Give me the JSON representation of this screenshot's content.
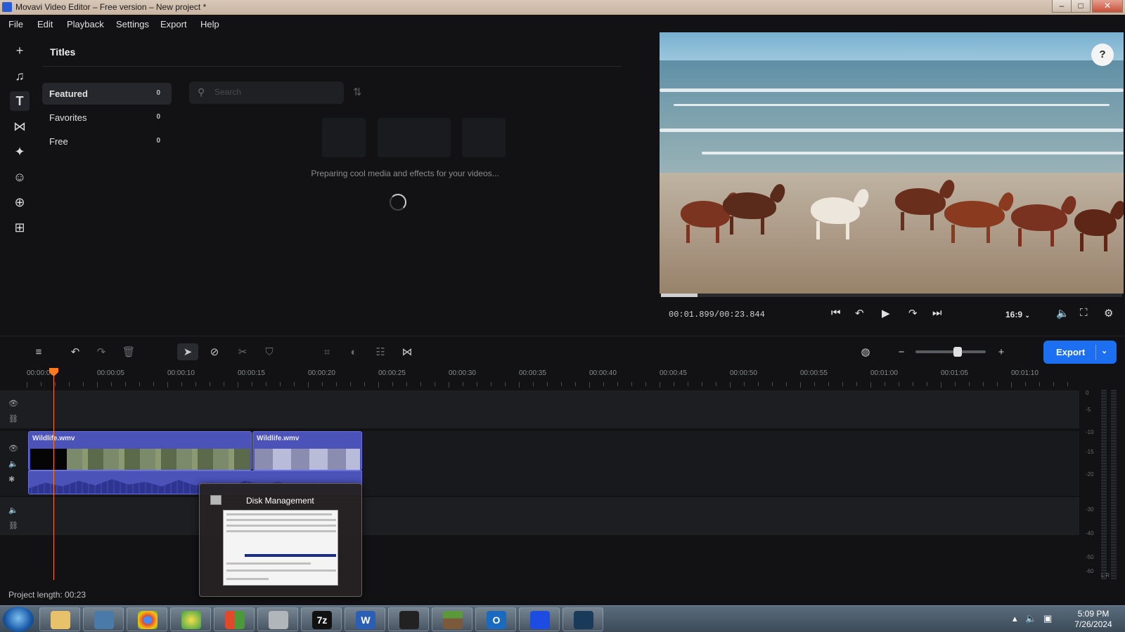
{
  "window": {
    "title": "Movavi Video Editor – Free version – New project *"
  },
  "menu": [
    "File",
    "Edit",
    "Playback",
    "Settings",
    "Export",
    "Help"
  ],
  "titles_panel": {
    "heading": "Titles",
    "categories": [
      {
        "label": "Featured",
        "count": "0"
      },
      {
        "label": "Favorites",
        "count": "0"
      },
      {
        "label": "Free",
        "count": "0"
      }
    ],
    "search_placeholder": "Search",
    "loading_text": "Preparing cool media and effects for your videos..."
  },
  "player": {
    "timecode": "00:01.899/00:23.844",
    "progress": 0.08,
    "aspect": "16:9"
  },
  "toolbar": {
    "export_label": "Export",
    "zoom_level": 0.6
  },
  "ruler": {
    "labels": [
      "00:00:00",
      "00:00:05",
      "00:00:10",
      "00:00:15",
      "00:00:20",
      "00:00:25",
      "00:00:30",
      "00:00:35",
      "00:00:40",
      "00:00:45",
      "00:00:50",
      "00:00:55",
      "00:01:00",
      "00:01:05",
      "00:01:10"
    ]
  },
  "timeline": {
    "clips": [
      {
        "name": "Wildlife.wmv"
      },
      {
        "name": "Wildlife.wmv"
      }
    ],
    "project_length": "Project length: 00:23"
  },
  "meter": {
    "labels": [
      "0",
      "-5",
      "-10",
      "-15",
      "-20",
      "-30",
      "-40",
      "-50",
      "-60"
    ],
    "channels": "L R"
  },
  "popup": {
    "title": "Disk Management"
  },
  "taskbar": {
    "apps": [
      "file-explorer",
      "computer",
      "chrome",
      "network",
      "office",
      "disk-management",
      "7zip",
      "word",
      "obs",
      "minecraft",
      "outlook",
      "movavi",
      "steam"
    ],
    "word_letter": "W",
    "outlook_letter": "O",
    "sevenzip_label": "7z",
    "clock_time": "5:09 PM",
    "clock_date": "7/26/2024"
  },
  "colors": {
    "accent": "#1d6ff2",
    "clip": "#4b52b8",
    "playhead": "#ff7a1a"
  }
}
